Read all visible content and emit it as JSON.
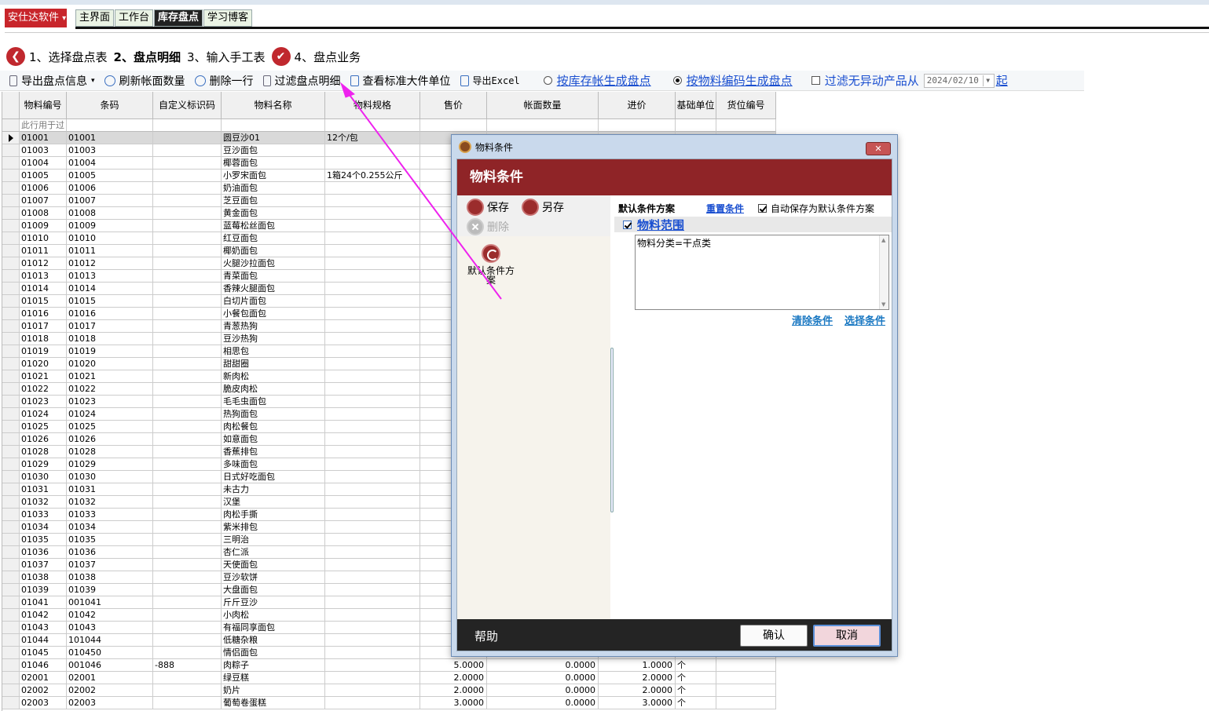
{
  "app_menu": {
    "label": "安仕达软件",
    "caret": "▾"
  },
  "nav_tabs": [
    {
      "label": "主界面"
    },
    {
      "label": "工作台"
    },
    {
      "label": "库存盘点"
    },
    {
      "label": "学习博客"
    }
  ],
  "steps": [
    {
      "label": "1、选择盘点表",
      "icon": "❮"
    },
    {
      "label": "2、盘点明细"
    },
    {
      "label": "3、输入手工表"
    },
    {
      "label": "4、盘点业务",
      "icon": "✔"
    }
  ],
  "toolbar": {
    "export_info": "导出盘点信息",
    "export_caret": "▾",
    "refresh_qty": "刷新帐面数量",
    "delete_row": "删除一行",
    "filter_detail": "过滤盘点明细",
    "view_unit": "查看标准大件单位",
    "export_excel": "导出Excel",
    "by_stock": "按库存帐生成盘点",
    "by_code": "按物料编码生成盘点",
    "filter_no_change": "过滤无异动产品从",
    "date": "2024/02/10",
    "date_suffix": "起"
  },
  "grid": {
    "headers": [
      "物料编号",
      "条码",
      "自定义标识码",
      "物料名称",
      "物料规格",
      "售价",
      "帐面数量",
      "进价",
      "基础单位",
      "货位编号"
    ],
    "filter_hint": "此行用于过",
    "rows": [
      [
        "01001",
        "01001",
        "",
        "圆豆沙01",
        "12个/包",
        "",
        "",
        "",
        "",
        ""
      ],
      [
        "01003",
        "01003",
        "",
        "豆沙面包",
        "",
        "",
        "",
        "",
        "",
        ""
      ],
      [
        "01004",
        "01004",
        "",
        "椰蓉面包",
        "",
        "",
        "",
        "",
        "",
        ""
      ],
      [
        "01005",
        "01005",
        "",
        "小罗宋面包",
        "1箱24个0.255公斤",
        "",
        "",
        "",
        "",
        ""
      ],
      [
        "01006",
        "01006",
        "",
        "奶油面包",
        "",
        "",
        "",
        "",
        "",
        ""
      ],
      [
        "01007",
        "01007",
        "",
        "芝豆面包",
        "",
        "",
        "",
        "",
        "",
        ""
      ],
      [
        "01008",
        "01008",
        "",
        "黄金面包",
        "",
        "",
        "",
        "",
        "",
        ""
      ],
      [
        "01009",
        "01009",
        "",
        "蓝莓松丝面包",
        "",
        "",
        "",
        "",
        "",
        ""
      ],
      [
        "01010",
        "01010",
        "",
        "红豆面包",
        "",
        "",
        "",
        "",
        "",
        ""
      ],
      [
        "01011",
        "01011",
        "",
        "椰奶面包",
        "",
        "",
        "",
        "",
        "",
        ""
      ],
      [
        "01012",
        "01012",
        "",
        "火腿沙拉面包",
        "",
        "",
        "",
        "",
        "",
        ""
      ],
      [
        "01013",
        "01013",
        "",
        "青菜面包",
        "",
        "",
        "",
        "",
        "",
        ""
      ],
      [
        "01014",
        "01014",
        "",
        "香辣火腿面包",
        "",
        "",
        "",
        "",
        "",
        ""
      ],
      [
        "01015",
        "01015",
        "",
        "白切片面包",
        "",
        "",
        "",
        "",
        "",
        ""
      ],
      [
        "01016",
        "01016",
        "",
        "小餐包面包",
        "",
        "",
        "",
        "",
        "",
        ""
      ],
      [
        "01017",
        "01017",
        "",
        "青葱热狗",
        "",
        "",
        "",
        "",
        "",
        ""
      ],
      [
        "01018",
        "01018",
        "",
        "豆沙热狗",
        "",
        "",
        "",
        "",
        "",
        ""
      ],
      [
        "01019",
        "01019",
        "",
        "相思包",
        "",
        "",
        "",
        "",
        "",
        ""
      ],
      [
        "01020",
        "01020",
        "",
        "甜甜圈",
        "",
        "",
        "",
        "",
        "",
        ""
      ],
      [
        "01021",
        "01021",
        "",
        "新肉松",
        "",
        "",
        "",
        "",
        "",
        ""
      ],
      [
        "01022",
        "01022",
        "",
        "脆皮肉松",
        "",
        "",
        "",
        "",
        "",
        ""
      ],
      [
        "01023",
        "01023",
        "",
        "毛毛虫面包",
        "",
        "",
        "",
        "",
        "",
        ""
      ],
      [
        "01024",
        "01024",
        "",
        "热狗面包",
        "",
        "",
        "",
        "",
        "",
        ""
      ],
      [
        "01025",
        "01025",
        "",
        "肉松餐包",
        "",
        "",
        "",
        "",
        "",
        ""
      ],
      [
        "01026",
        "01026",
        "",
        "如意面包",
        "",
        "",
        "",
        "",
        "",
        ""
      ],
      [
        "01028",
        "01028",
        "",
        "香蕉排包",
        "",
        "",
        "",
        "",
        "",
        ""
      ],
      [
        "01029",
        "01029",
        "",
        "多味面包",
        "",
        "",
        "",
        "",
        "",
        ""
      ],
      [
        "01030",
        "01030",
        "",
        "日式好吃面包",
        "",
        "",
        "",
        "",
        "",
        ""
      ],
      [
        "01031",
        "01031",
        "",
        "未古力",
        "",
        "",
        "",
        "",
        "",
        ""
      ],
      [
        "01032",
        "01032",
        "",
        "汉堡",
        "",
        "",
        "",
        "",
        "",
        ""
      ],
      [
        "01033",
        "01033",
        "",
        "肉松手撕",
        "",
        "",
        "",
        "",
        "",
        ""
      ],
      [
        "01034",
        "01034",
        "",
        "紫米排包",
        "",
        "",
        "",
        "",
        "",
        ""
      ],
      [
        "01035",
        "01035",
        "",
        "三明治",
        "",
        "",
        "",
        "",
        "",
        ""
      ],
      [
        "01036",
        "01036",
        "",
        "杏仁派",
        "",
        "",
        "",
        "",
        "",
        ""
      ],
      [
        "01037",
        "01037",
        "",
        "天使面包",
        "",
        "",
        "",
        "",
        "",
        ""
      ],
      [
        "01038",
        "01038",
        "",
        "豆沙软饼",
        "",
        "",
        "",
        "",
        "",
        ""
      ],
      [
        "01039",
        "01039",
        "",
        "大盘面包",
        "",
        "",
        "",
        "",
        "",
        ""
      ],
      [
        "01041",
        "001041",
        "",
        "斤斤豆沙",
        "",
        "",
        "",
        "",
        "",
        ""
      ],
      [
        "01042",
        "01042",
        "",
        "小肉松",
        "",
        "",
        "",
        "",
        "",
        ""
      ],
      [
        "01043",
        "01043",
        "",
        "有福同享面包",
        "",
        "",
        "",
        "",
        "",
        ""
      ],
      [
        "01044",
        "101044",
        "",
        "低糖杂粮",
        "",
        "",
        "",
        "",
        "",
        ""
      ],
      [
        "01045",
        "010450",
        "",
        "情侣面包",
        "",
        "",
        "",
        "",
        "",
        ""
      ],
      [
        "01046",
        "001046",
        "-888",
        "肉粽子",
        "",
        "5.0000",
        "0.0000",
        "1.0000",
        "个",
        ""
      ],
      [
        "02001",
        "02001",
        "",
        "绿豆糕",
        "",
        "2.0000",
        "0.0000",
        "2.0000",
        "个",
        ""
      ],
      [
        "02002",
        "02002",
        "",
        "奶片",
        "",
        "2.0000",
        "0.0000",
        "2.0000",
        "个",
        ""
      ],
      [
        "02003",
        "02003",
        "",
        "葡萄卷蛋糕",
        "",
        "3.0000",
        "0.0000",
        "3.0000",
        "个",
        ""
      ]
    ]
  },
  "dialog": {
    "window_title": "物料条件",
    "close": "✕",
    "header": "物料条件",
    "save": "保存",
    "save_as": "另存",
    "delete": "删除",
    "scheme_item": "默认条件方案",
    "scheme_label": "默认条件方案",
    "reset": "重置条件",
    "autosave": "自动保存为默认条件方案",
    "range_title": "物料范围",
    "range_text": "物料分类=干点类",
    "clear": "清除条件",
    "choose": "选择条件",
    "help": "帮助",
    "ok": "确认",
    "cancel": "取消"
  },
  "colors": {
    "brand_red": "#c8252b",
    "header_red": "#8f2427",
    "annotation_arrow": "#ee22ee"
  }
}
